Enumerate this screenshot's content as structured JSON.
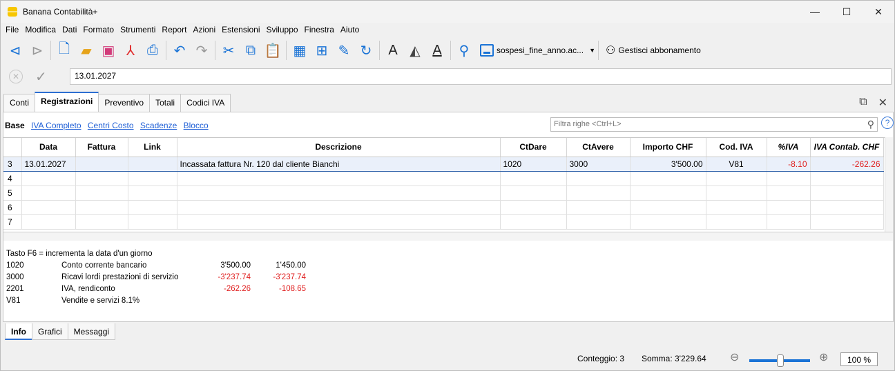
{
  "app": {
    "title": "Banana Contabilità+"
  },
  "menu": [
    "File",
    "Modifica",
    "Dati",
    "Formato",
    "Strumenti",
    "Report",
    "Azioni",
    "Estensioni",
    "Sviluppo",
    "Finestra",
    "Aiuto"
  ],
  "toolbar": {
    "file_name": "sospesi_fine_anno.ac...",
    "subscription": "Gestisci abbonamento"
  },
  "edit": {
    "value": "13.01.2027"
  },
  "tabs": [
    "Conti",
    "Registrazioni",
    "Preventivo",
    "Totali",
    "Codici IVA"
  ],
  "views": {
    "base": "Base",
    "links": [
      "IVA Completo",
      "Centri Costo",
      "Scadenze",
      "Blocco"
    ]
  },
  "filter": {
    "placeholder": "Filtra righe <Ctrl+L>"
  },
  "table": {
    "headers": [
      "Data",
      "Fattura",
      "Link",
      "Descrizione",
      "CtDare",
      "CtAvere",
      "Importo CHF",
      "Cod. IVA",
      "%IVA",
      "IVA Contab. CHF"
    ],
    "rows": [
      {
        "n": "3",
        "data": "13.01.2027",
        "fattura": "",
        "link": "",
        "descr": "Incassata fattura Nr. 120 dal cliente Bianchi",
        "dare": "1020",
        "avere": "3000",
        "importo": "3'500.00",
        "cod": "V81",
        "piva": "-8.10",
        "ivac": "-262.26"
      },
      {
        "n": "4"
      },
      {
        "n": "5"
      },
      {
        "n": "6"
      },
      {
        "n": "7"
      }
    ]
  },
  "info": {
    "hint": "Tasto F6 = incrementa la data d'un giorno",
    "lines": [
      {
        "acc": "1020",
        "desc": "Conto corrente bancario",
        "v1": "3'500.00",
        "v2": "1'450.00"
      },
      {
        "acc": "3000",
        "desc": "Ricavi lordi prestazioni di servizio",
        "v1": "-3'237.74",
        "v2": "-3'237.74"
      },
      {
        "acc": "2201",
        "desc": "IVA, rendiconto",
        "v1": "-262.26",
        "v2": "-108.65"
      },
      {
        "acc": "V81",
        "desc": "Vendite e servizi 8.1%",
        "v1": "",
        "v2": ""
      }
    ]
  },
  "bottom_tabs": [
    "Info",
    "Grafici",
    "Messaggi"
  ],
  "status": {
    "count": "Conteggio: 3",
    "sum": "Somma: 3'229.64",
    "zoom": "100 %"
  },
  "colors": {
    "accent": "#2d6fd2",
    "negative": "#e02020"
  }
}
